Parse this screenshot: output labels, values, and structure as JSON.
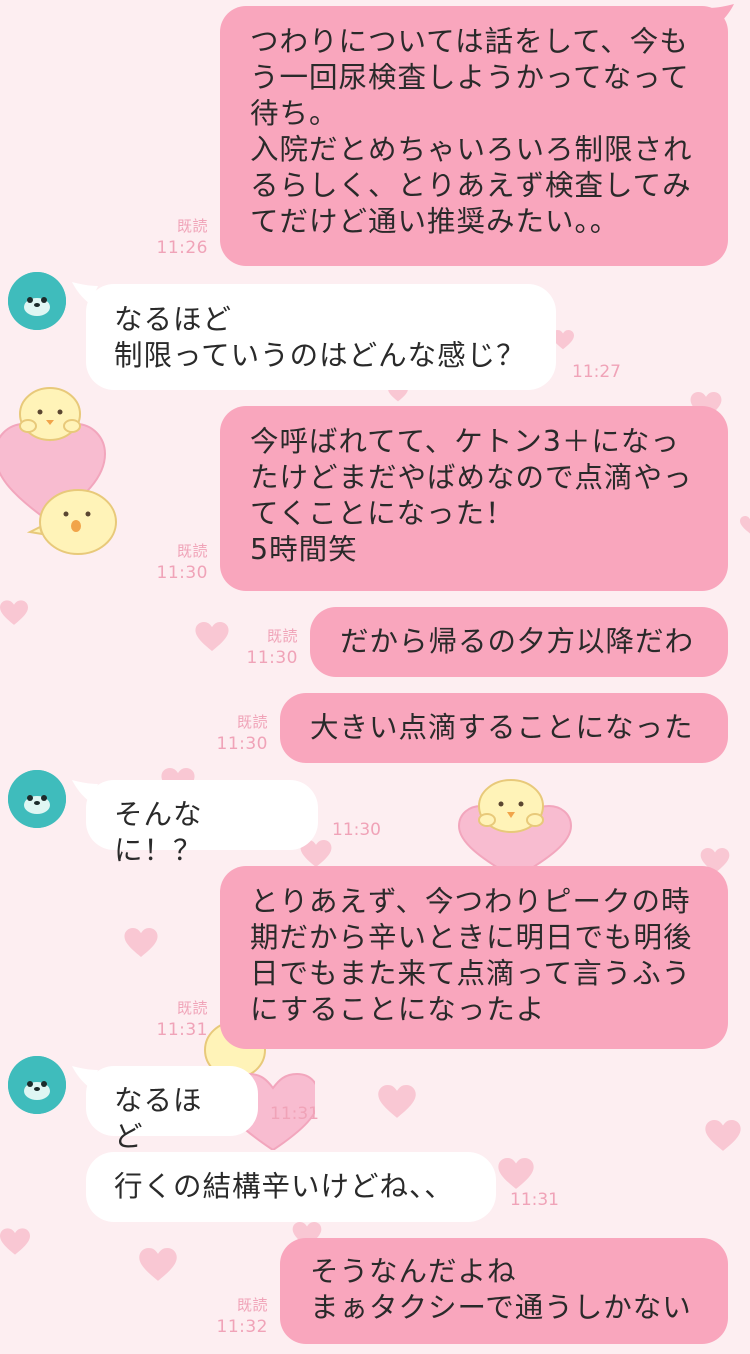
{
  "messages": [
    {
      "side": "out",
      "text": "つわりについては話をして、今も\nう一回尿検査しようかってなって\n待ち。\n入院だとめちゃいろいろ制限され\nるらしく、とりあえず検査してみ\nてだけど通い推奨みたい。。",
      "read": "既読",
      "time": "11:26"
    },
    {
      "side": "in",
      "text": "なるほど\n制限っていうのはどんな感じ？",
      "time": "11:27"
    },
    {
      "side": "out",
      "text": "今呼ばれてて、ケトン3＋になっ\nたけどまだやばめなので点滴やっ\nてくことになった！\n5時間笑",
      "read": "既読",
      "time": "11:30"
    },
    {
      "side": "out",
      "text": "だから帰るの夕方以降だわ",
      "read": "既読",
      "time": "11:30"
    },
    {
      "side": "out",
      "text": "大きい点滴することになった",
      "read": "既読",
      "time": "11:30"
    },
    {
      "side": "in",
      "text": "そんなに！？",
      "time": "11:30"
    },
    {
      "side": "out",
      "text": "とりあえず、今つわりピークの時\n期だから辛いときに明日でも明後\n日でもまた来て点滴って言うふう\nにすることになったよ",
      "read": "既読",
      "time": "11:31"
    },
    {
      "side": "in",
      "text": "なるほど",
      "time": "11:31"
    },
    {
      "side": "in",
      "text": "行くの結構辛いけどね、、",
      "time": "11:31"
    },
    {
      "side": "out",
      "text": "そうなんだよね\nまぁタクシーで通うしかない",
      "read": "既読",
      "time": "11:32"
    }
  ],
  "colors": {
    "outgoing_bubble": "#f9a6bd",
    "incoming_bubble": "#ffffff",
    "background": "#fdeef1",
    "meta_text": "#f0a3b8",
    "avatar": "#3fbcbc"
  },
  "icons": {
    "avatar": "avatar-icon",
    "wallpaper_hearts": "heart-icon",
    "wallpaper_chicks": "chick-icon"
  }
}
